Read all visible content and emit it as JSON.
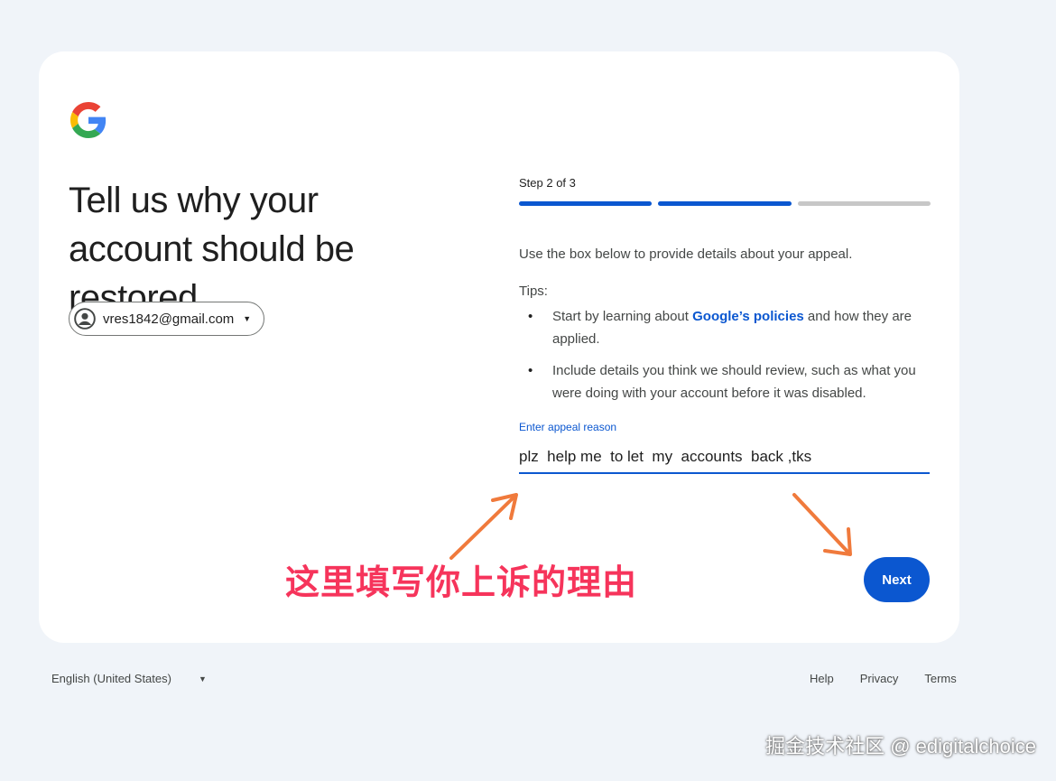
{
  "page": {
    "headline": "Tell us why your account should be restored",
    "account_email": "vres1842@gmail.com"
  },
  "stepper": {
    "label": "Step 2 of 3",
    "current": 2,
    "total": 3
  },
  "content": {
    "intro": "Use the box below to provide details about your appeal.",
    "tips_label": "Tips:",
    "tip1_before": "Start by learning about ",
    "tip1_link": "Google’s policies",
    "tip1_after": " and how they are applied.",
    "tip2": "Include details you think we should review, such as what you were doing with your account before it was disabled."
  },
  "form": {
    "field_label": "Enter appeal reason",
    "field_value": "plz  help me  to let  my  accounts  back ,tks"
  },
  "buttons": {
    "next": "Next"
  },
  "annotation": {
    "text": "这里填写你上诉的理由",
    "color": "#f6345b"
  },
  "footer": {
    "language": "English (United States)",
    "help": "Help",
    "privacy": "Privacy",
    "terms": "Terms"
  },
  "watermark": "掘金技术社区 @ edigitalchoice",
  "colors": {
    "accent": "#0b57d0",
    "background": "#f0f4f9",
    "arrow": "#f07a3c"
  },
  "icons": [
    "google-logo",
    "account-circle-icon",
    "chevron-down-icon"
  ]
}
